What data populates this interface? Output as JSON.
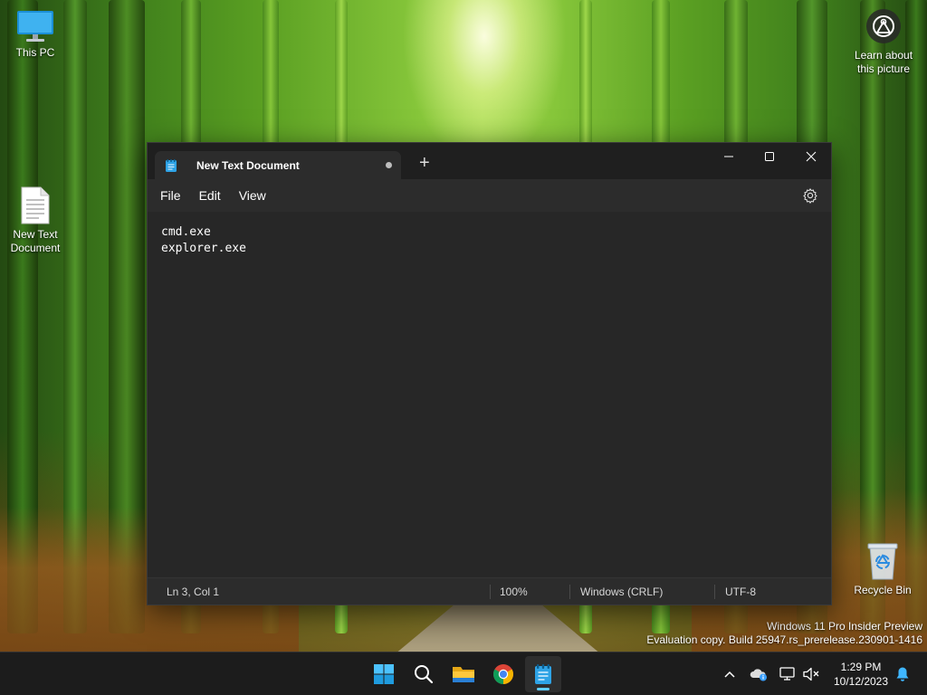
{
  "desktop": {
    "icons": {
      "this_pc": "This PC",
      "new_text_document": "New Text\nDocument",
      "recycle_bin": "Recycle Bin"
    },
    "learn_picture": "Learn about\nthis picture",
    "watermark": {
      "line1": "Windows 11 Pro Insider Preview",
      "line2": "Evaluation copy. Build 25947.rs_prerelease.230901-1416"
    }
  },
  "notepad": {
    "tab_title": "New Text Document",
    "new_tab_label": "+",
    "menus": {
      "file": "File",
      "edit": "Edit",
      "view": "View"
    },
    "content_lines": [
      "cmd.exe",
      "explorer.exe"
    ],
    "status": {
      "position": "Ln 3, Col 1",
      "zoom": "100%",
      "line_ending": "Windows (CRLF)",
      "encoding": "UTF-8"
    },
    "window_controls": {
      "minimize": "—",
      "maximize": "☐",
      "close": "✕"
    }
  },
  "taskbar": {
    "clock": {
      "time": "1:29 PM",
      "date": "10/12/2023"
    },
    "apps": [
      "start-icon",
      "search-icon",
      "file-explorer-icon",
      "chrome-icon",
      "notepad-icon"
    ]
  },
  "colors": {
    "accent": "#60cdff",
    "window_bg": "#272727",
    "titlebar_bg": "#1f1f1f",
    "taskbar_bg": "#1c1c1c"
  }
}
